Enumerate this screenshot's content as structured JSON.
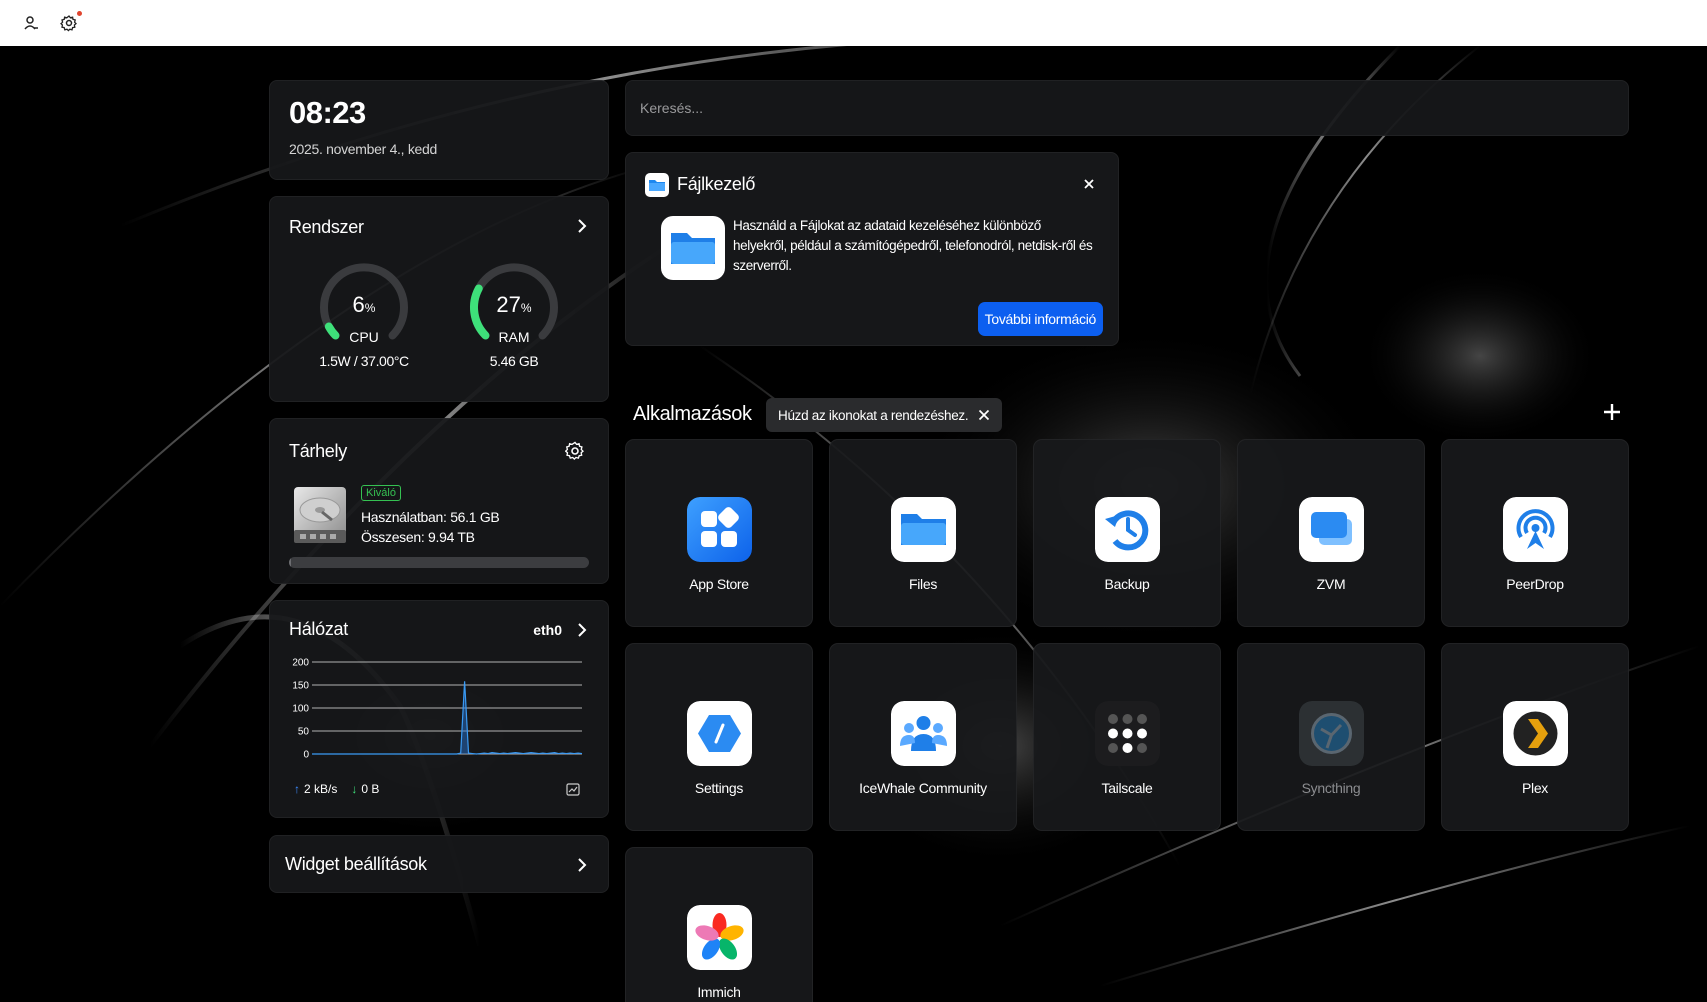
{
  "topbar": {
    "user_icon": "user-icon",
    "settings_icon": "gear-icon"
  },
  "clock": {
    "time": "08:23",
    "date": "2025. november 4., kedd"
  },
  "system": {
    "title": "Rendszer",
    "cpu": {
      "value": "6",
      "unit": "%",
      "label": "CPU",
      "detail": "1.5W / 37.00°C",
      "percent": 6
    },
    "ram": {
      "value": "27",
      "unit": "%",
      "label": "RAM",
      "detail": "5.46 GB",
      "percent": 27
    }
  },
  "storage": {
    "title": "Tárhely",
    "badge": "Kiváló",
    "used": "Használatban: 56.1 GB",
    "total": "Összesen: 9.94 TB",
    "used_fraction": 0.0056
  },
  "network": {
    "title": "Hálózat",
    "interface": "eth0",
    "upload": "2 kB/s",
    "download": "0 B",
    "chart_data": {
      "type": "line",
      "yticks": [
        "200",
        "150",
        "100",
        "50",
        "0"
      ],
      "ylim": [
        0,
        200
      ],
      "series": [
        {
          "values": [
            0,
            0,
            0,
            0,
            0,
            0,
            0,
            0,
            0,
            0,
            0,
            0,
            0,
            0,
            0,
            0,
            0,
            0,
            0,
            0,
            0,
            0,
            0,
            0,
            0,
            0,
            0,
            0,
            0,
            0,
            0,
            0,
            0,
            0,
            0,
            0,
            0,
            0,
            2,
            158,
            2,
            1,
            0,
            1,
            2,
            1,
            3,
            2,
            1,
            2,
            1,
            2,
            3,
            2,
            1,
            2,
            3,
            2,
            1,
            2,
            1,
            2,
            3,
            1,
            2,
            1,
            2,
            1,
            2,
            1
          ]
        }
      ]
    }
  },
  "widgets": {
    "label": "Widget beállítások"
  },
  "search": {
    "placeholder": "Keresés..."
  },
  "file_manager": {
    "title": "Fájlkezelő",
    "description": "Használd a Fájlokat az adataid kezeléséhez különböző helyekről, például a számítógépedről, telefonodról, netdisk-ről és szerverről.",
    "button": "További információ"
  },
  "apps": {
    "title": "Alkalmazások",
    "tip": "Húzd az ikonokat a rendezéshez.",
    "items": [
      {
        "name": "App Store"
      },
      {
        "name": "Files"
      },
      {
        "name": "Backup"
      },
      {
        "name": "ZVM"
      },
      {
        "name": "PeerDrop"
      },
      {
        "name": "Settings"
      },
      {
        "name": "IceWhale Community"
      },
      {
        "name": "Tailscale"
      },
      {
        "name": "Syncthing"
      },
      {
        "name": "Plex"
      },
      {
        "name": "Immich"
      }
    ]
  },
  "colors": {
    "accent_blue": "#0c5ff0",
    "gauge_green": "#3ee07a",
    "badge_green": "#35c152"
  }
}
